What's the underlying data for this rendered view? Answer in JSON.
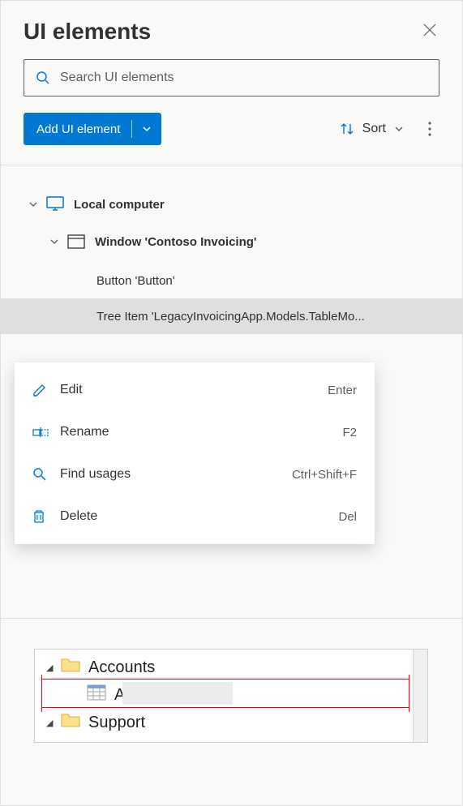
{
  "panel": {
    "title": "UI elements",
    "search_placeholder": "Search UI elements",
    "add_button_label": "Add UI element",
    "sort_label": "Sort"
  },
  "tree": {
    "root": {
      "label": "Local computer",
      "icon": "monitor-icon"
    },
    "window": {
      "label": "Window 'Contoso Invoicing'",
      "icon": "window-icon"
    },
    "items": [
      {
        "label": "Button 'Button'",
        "selected": false
      },
      {
        "label": "Tree Item 'LegacyInvoicingApp.Models.TableMo...",
        "selected": true
      }
    ]
  },
  "context_menu": [
    {
      "icon": "edit-icon",
      "label": "Edit",
      "shortcut": "Enter"
    },
    {
      "icon": "rename-icon",
      "label": "Rename",
      "shortcut": "F2"
    },
    {
      "icon": "find-icon",
      "label": "Find usages",
      "shortcut": "Ctrl+Shift+F"
    },
    {
      "icon": "delete-icon",
      "label": "Delete",
      "shortcut": "Del"
    }
  ],
  "preview": {
    "rows": [
      {
        "label": "Accounts",
        "icon": "folder",
        "indent": 0
      },
      {
        "label": "Accounts",
        "icon": "table",
        "indent": 1
      },
      {
        "label": "Support",
        "icon": "folder",
        "indent": 0
      }
    ]
  },
  "colors": {
    "primary": "#0078d4",
    "highlight": "#ff0000"
  }
}
